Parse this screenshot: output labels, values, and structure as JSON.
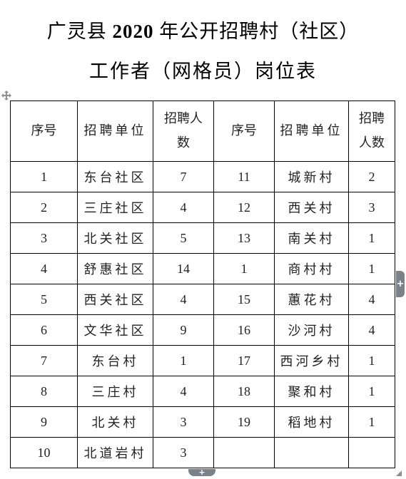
{
  "document": {
    "title_line1_prefix": "广灵县",
    "title_line1_year": " 2020 ",
    "title_line1_suffix": "年公开招聘村（社区）",
    "title_line2": "工作者（网格员）岗位表"
  },
  "table": {
    "headers": {
      "left": {
        "seq": "序号",
        "unit": "招聘单位",
        "count_line1": "招聘人",
        "count_line2": "数"
      },
      "right": {
        "seq": "序号",
        "unit": "招聘单位",
        "count_line1": "招聘",
        "count_line2": "人数"
      }
    },
    "rows": [
      {
        "left": {
          "seq": "1",
          "unit": "东台社区",
          "count": "7"
        },
        "right": {
          "seq": "11",
          "unit": "城新村",
          "count": "2"
        }
      },
      {
        "left": {
          "seq": "2",
          "unit": "三庄社区",
          "count": "4"
        },
        "right": {
          "seq": "12",
          "unit": "西关村",
          "count": "3"
        }
      },
      {
        "left": {
          "seq": "3",
          "unit": "北关社区",
          "count": "5"
        },
        "right": {
          "seq": "13",
          "unit": "南关村",
          "count": "1"
        }
      },
      {
        "left": {
          "seq": "4",
          "unit": "舒惠社区",
          "count": "14"
        },
        "right": {
          "seq": "1",
          "unit": "商村村",
          "count": "1"
        }
      },
      {
        "left": {
          "seq": "5",
          "unit": "西关社区",
          "count": "4"
        },
        "right": {
          "seq": "15",
          "unit": "蕙花村",
          "count": "4"
        }
      },
      {
        "left": {
          "seq": "6",
          "unit": "文华社区",
          "count": "9"
        },
        "right": {
          "seq": "16",
          "unit": "沙河村",
          "count": "4"
        }
      },
      {
        "left": {
          "seq": "7",
          "unit": "东台村",
          "count": "1"
        },
        "right": {
          "seq": "17",
          "unit": "西河乡村",
          "count": "1"
        }
      },
      {
        "left": {
          "seq": "8",
          "unit": "三庄村",
          "count": "4"
        },
        "right": {
          "seq": "18",
          "unit": "聚和村",
          "count": "1"
        }
      },
      {
        "left": {
          "seq": "9",
          "unit": "北关村",
          "count": "3"
        },
        "right": {
          "seq": "19",
          "unit": "稻地村",
          "count": "1"
        }
      },
      {
        "left": {
          "seq": "10",
          "unit": "北道岩村",
          "count": "3"
        },
        "right": {
          "seq": "",
          "unit": "",
          "count": ""
        }
      }
    ]
  },
  "editor_handles": {
    "move_icon": "four-arrows-move-icon",
    "add_column_icon": "plus-icon",
    "add_row_icon": "plus-icon",
    "resize_icon": "corner-resize-icon",
    "handle_color": "#7a8189"
  }
}
